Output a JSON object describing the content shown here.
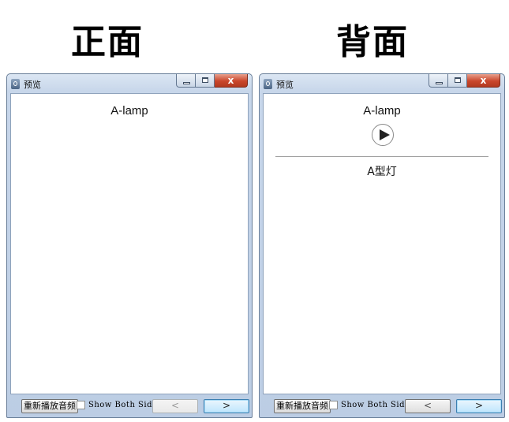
{
  "headings": {
    "front": "正面",
    "back": "背面"
  },
  "windows": [
    {
      "side": "front",
      "title": "预览",
      "close_glyph": "x",
      "word": "A-lamp",
      "show_play": false,
      "meaning": "",
      "footer": {
        "replay_label": "重新播放音频",
        "show_both_label": "Show Both Sides",
        "show_both_checked": false,
        "prev_label": "<",
        "next_label": ">",
        "prev_enabled": false
      }
    },
    {
      "side": "back",
      "title": "预览",
      "close_glyph": "x",
      "word": "A-lamp",
      "show_play": true,
      "meaning": "A型灯",
      "footer": {
        "replay_label": "重新播放音频",
        "show_both_label": "Show Both Sides",
        "show_both_checked": false,
        "prev_label": "<",
        "next_label": ">",
        "prev_enabled": true
      }
    }
  ],
  "icons": {
    "app": "anki-app-icon",
    "minimize": "minimize-icon",
    "maximize": "maximize-icon",
    "close": "close-icon",
    "play": "play-icon"
  },
  "colors": {
    "close_button": "#c9462b",
    "window_frame": "#bccde4",
    "focused_button": "#3c7fb1"
  }
}
